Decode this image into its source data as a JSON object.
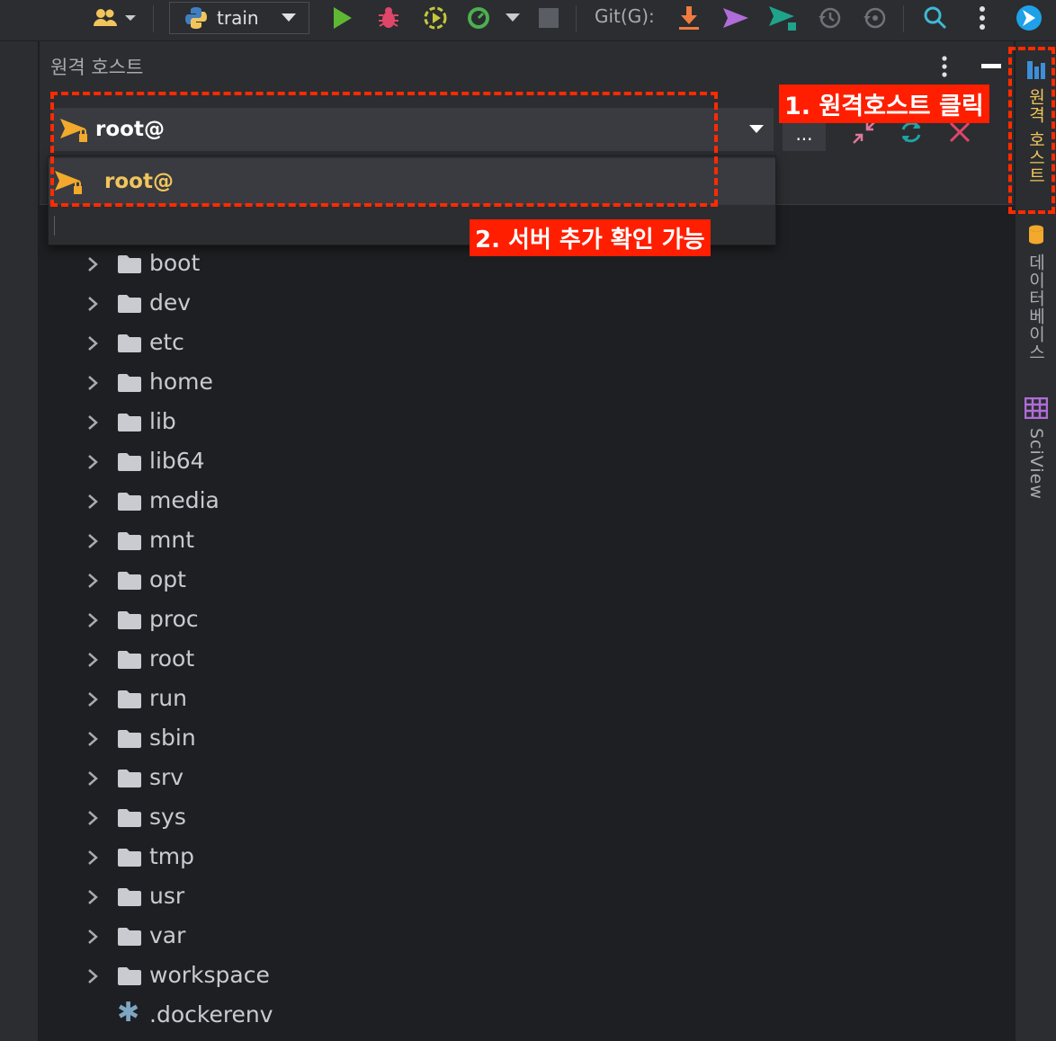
{
  "toolbar": {
    "run_config": "train",
    "git_label": "Git(G):"
  },
  "panel": {
    "title": "원격 호스트",
    "connection": "root@",
    "more_label": "..."
  },
  "dropdown": {
    "items": [
      "root@"
    ]
  },
  "tree": {
    "folders": [
      "boot",
      "dev",
      "etc",
      "home",
      "lib",
      "lib64",
      "media",
      "mnt",
      "opt",
      "proc",
      "root",
      "run",
      "sbin",
      "srv",
      "sys",
      "tmp",
      "usr",
      "var",
      "workspace"
    ],
    "files": [
      ".dockerenv"
    ]
  },
  "right_strip": {
    "tabs": [
      {
        "label": "원격 호스트",
        "icon": "remote-host-icon",
        "color": "#f2c55c",
        "active": true
      },
      {
        "label": "데이터베이스",
        "icon": "database-icon",
        "color": "#a9abb0"
      },
      {
        "label": "SciView",
        "icon": "sciview-icon",
        "color": "#a9abb0"
      }
    ]
  },
  "annotations": {
    "step1": "1. 원격호스트 클릭",
    "step2": "2. 서버 추가 확인 가능"
  },
  "colors": {
    "annotation_red": "#ff1e00",
    "accent_yellow": "#f2c55c",
    "background": "#1e1f22",
    "panel": "#2b2d30"
  }
}
